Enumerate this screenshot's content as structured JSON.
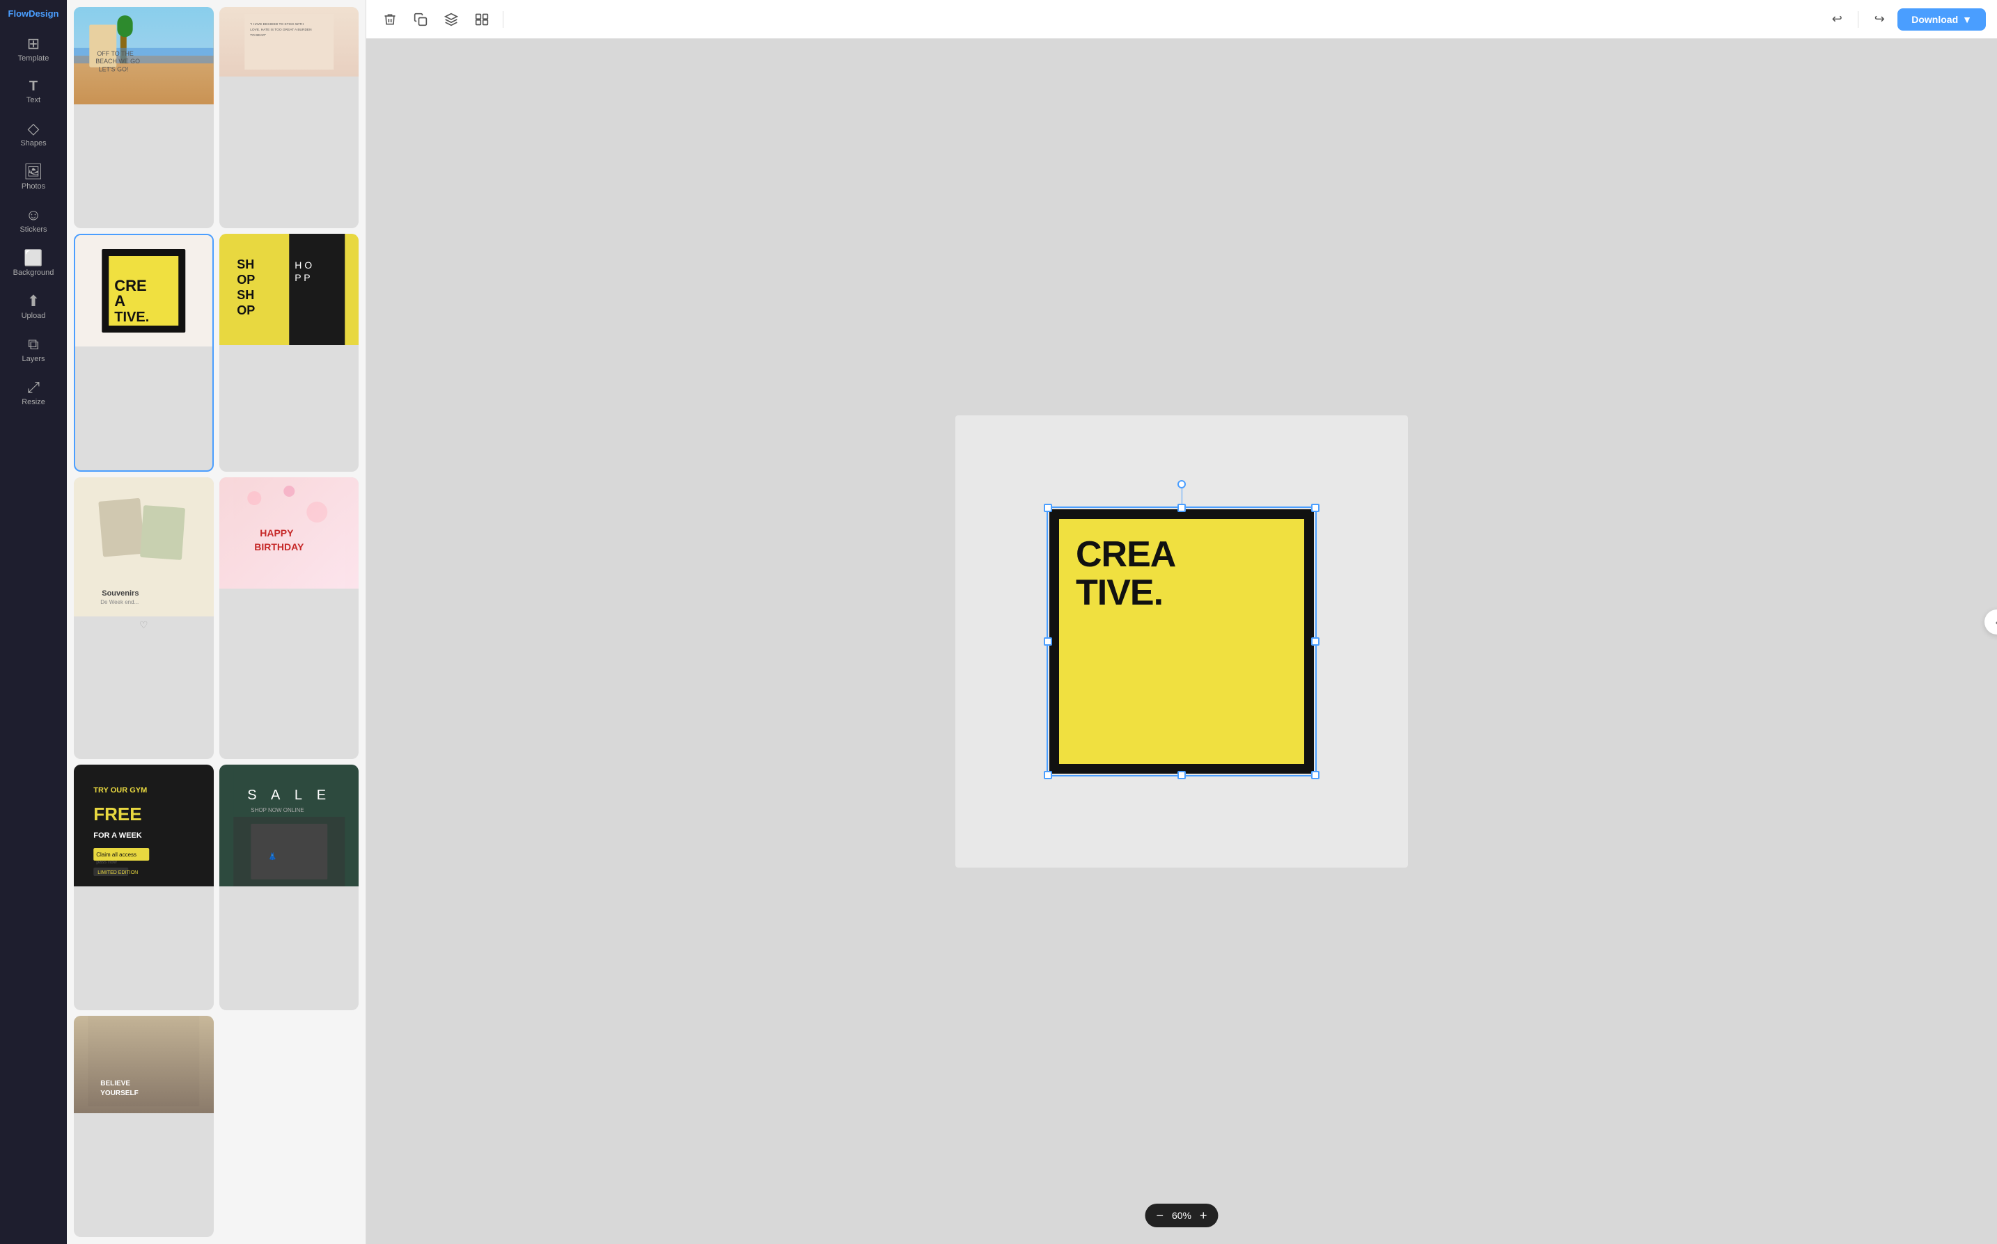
{
  "app": {
    "name": "FlowDesign"
  },
  "header": {
    "download_label": "Download",
    "zoom_level": "60%"
  },
  "sidebar": {
    "items": [
      {
        "id": "template",
        "label": "Template",
        "icon": "⊞"
      },
      {
        "id": "text",
        "label": "Text",
        "icon": "T"
      },
      {
        "id": "shapes",
        "label": "Shapes",
        "icon": "◇"
      },
      {
        "id": "photos",
        "label": "Photos",
        "icon": "🖼"
      },
      {
        "id": "stickers",
        "label": "Stickers",
        "icon": "☺"
      },
      {
        "id": "background",
        "label": "Background",
        "icon": "⬜"
      },
      {
        "id": "upload",
        "label": "Upload",
        "icon": "⬆"
      },
      {
        "id": "layers",
        "label": "Layers",
        "icon": "⧉"
      },
      {
        "id": "resize",
        "label": "Resize",
        "icon": "⤢"
      }
    ]
  },
  "toolbar": {
    "delete_title": "Delete",
    "duplicate_title": "Duplicate",
    "layers_title": "Layers",
    "group_title": "Group",
    "undo_title": "Undo",
    "redo_title": "Redo"
  },
  "canvas": {
    "design_text_line1": "CREA",
    "design_text_line2": "TIVE."
  },
  "templates": [
    {
      "id": "beach",
      "type": "beach",
      "label": ""
    },
    {
      "id": "quote",
      "type": "quote",
      "label": ""
    },
    {
      "id": "creative",
      "type": "creative",
      "label": ""
    },
    {
      "id": "shop",
      "type": "shop",
      "label": ""
    },
    {
      "id": "souvenir",
      "type": "souvenir",
      "label": "Souvenirs"
    },
    {
      "id": "birthday",
      "type": "birthday",
      "label": ""
    },
    {
      "id": "gym",
      "type": "gym",
      "label": ""
    },
    {
      "id": "sale",
      "type": "sale",
      "label": ""
    },
    {
      "id": "believe",
      "type": "believe",
      "label": ""
    }
  ]
}
